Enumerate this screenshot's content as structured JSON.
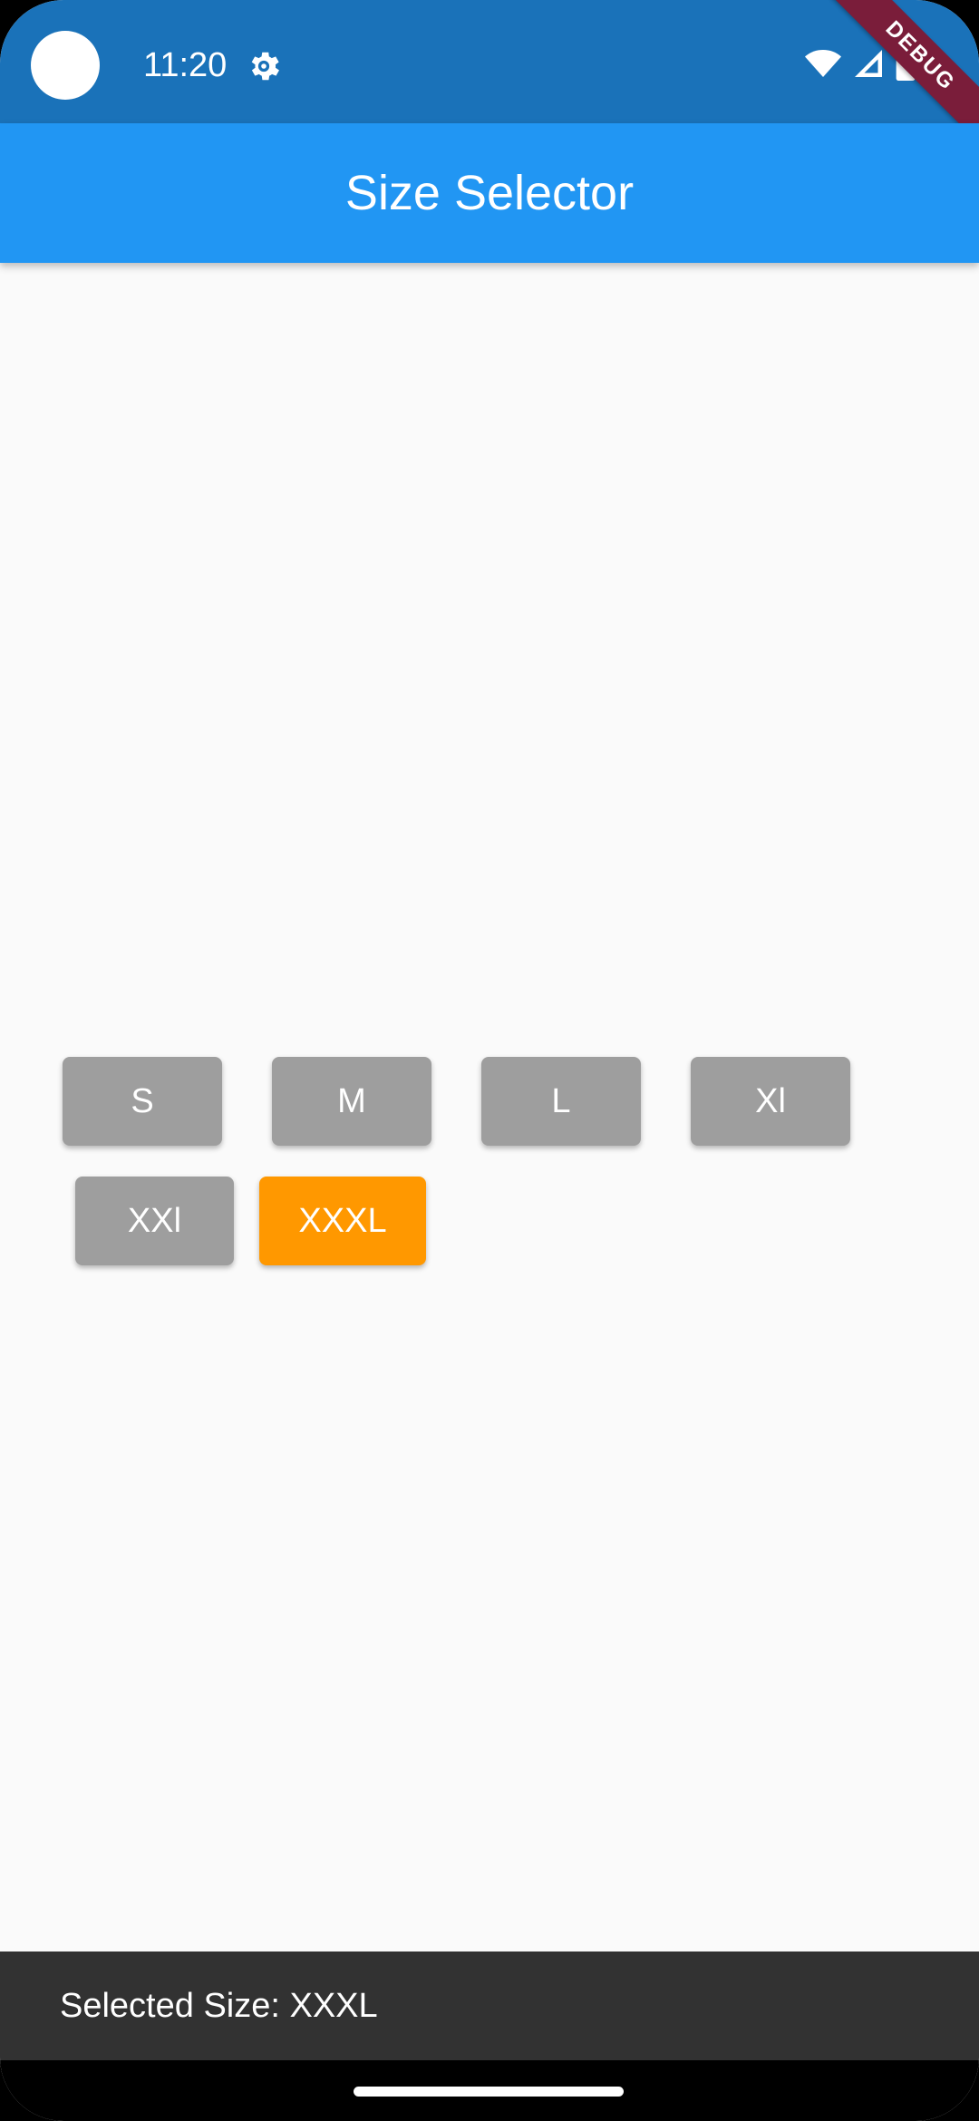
{
  "status_bar": {
    "time": "11:20",
    "settings_icon": "gear-icon",
    "wifi_icon": "wifi-icon",
    "signal_icon": "signal-icon",
    "battery_icon": "battery-icon",
    "debug_label": "DEBUG"
  },
  "app_bar": {
    "title": "Size Selector"
  },
  "sizes": [
    {
      "label": "S",
      "selected": false
    },
    {
      "label": "M",
      "selected": false
    },
    {
      "label": "L",
      "selected": false
    },
    {
      "label": "Xl",
      "selected": false
    },
    {
      "label": "XXl",
      "selected": false
    },
    {
      "label": "XXXL",
      "selected": true
    }
  ],
  "colors": {
    "status_bar": "#1a72b9",
    "app_bar": "#2196f3",
    "button_default": "#9e9e9e",
    "button_selected": "#ff9800",
    "snackbar": "#323232"
  },
  "snackbar": {
    "message": "Selected Size: XXXL"
  }
}
